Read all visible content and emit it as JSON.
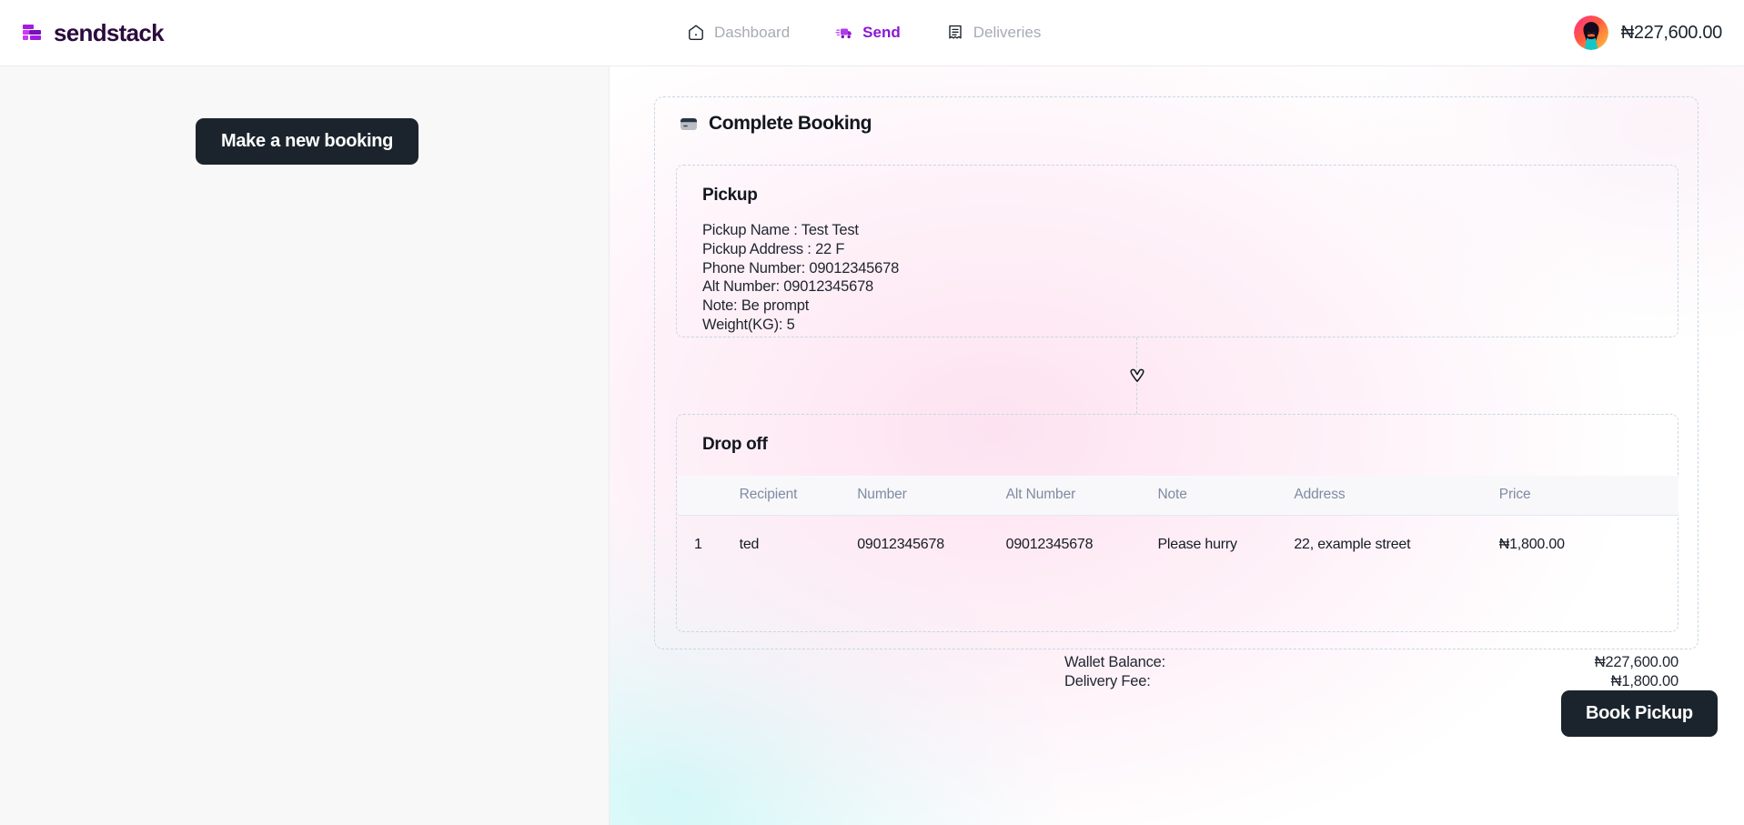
{
  "brand": {
    "name": "sendstack"
  },
  "nav": {
    "items": [
      {
        "label": "Dashboard",
        "icon": "home-icon",
        "active": false
      },
      {
        "label": "Send",
        "icon": "truck-icon",
        "active": true
      },
      {
        "label": "Deliveries",
        "icon": "receipt-icon",
        "active": false
      }
    ]
  },
  "wallet": {
    "amount": "₦227,600.00",
    "avatar_icon": "user-avatar"
  },
  "left": {
    "new_booking_label": "Make a new booking"
  },
  "booking": {
    "title": "Complete Booking",
    "title_icon": "card-icon",
    "connector_icon": "chevron-down-heart-icon",
    "pickup": {
      "heading": "Pickup",
      "lines": [
        "Pickup Name : Test Test",
        "Pickup Address : 22 F",
        "Phone Number: 09012345678",
        "Alt Number: 09012345678",
        "Note: Be prompt",
        "Weight(KG): 5"
      ]
    },
    "dropoff": {
      "heading": "Drop off",
      "columns": [
        "",
        "Recipient",
        "Number",
        "Alt Number",
        "Note",
        "Address",
        "Price"
      ],
      "rows": [
        {
          "index": "1",
          "recipient": "ted",
          "number": "09012345678",
          "alt_number": "09012345678",
          "note": "Please hurry",
          "address": "22, example street",
          "price": "₦1,800.00"
        }
      ]
    },
    "totals": {
      "wallet_label": "Wallet Balance:",
      "wallet_value": "₦227,600.00",
      "fee_label": "Delivery Fee:",
      "fee_value": "₦1,800.00"
    },
    "submit_label": "Book Pickup"
  },
  "colors": {
    "accent_purple": "#8B18D6",
    "brand_dark": "#2B0B3D",
    "button_dark": "#1B242C",
    "dashed_border": "#C8D7E2",
    "muted_text": "#A7ABB8"
  }
}
